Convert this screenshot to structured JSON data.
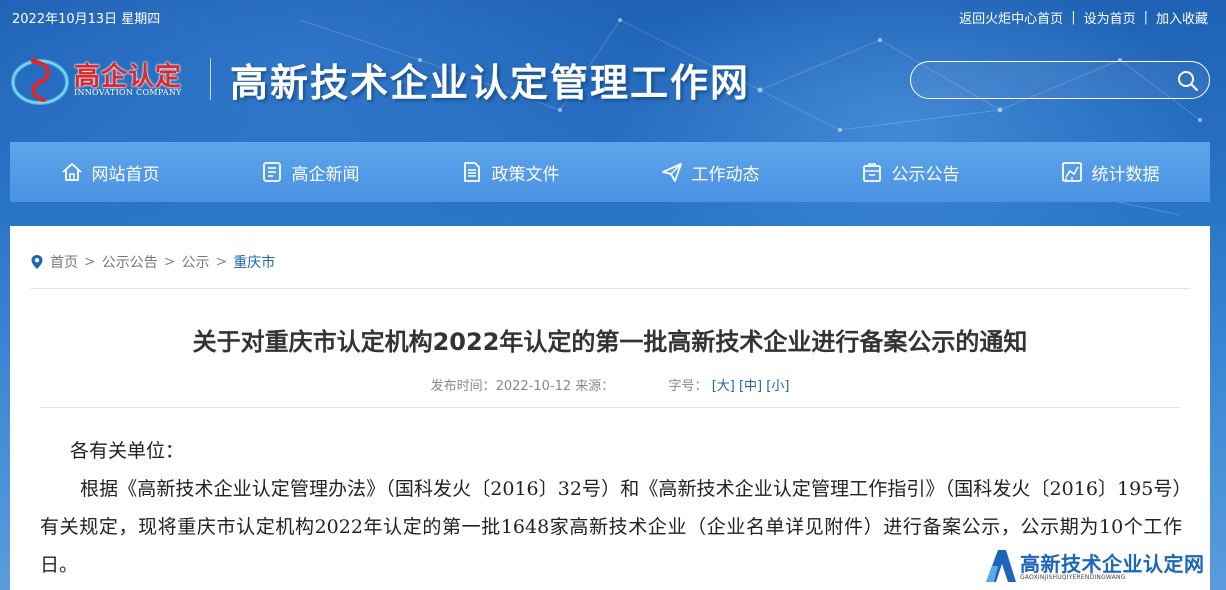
{
  "topbar": {
    "date": "2022年10月13日 星期四",
    "links": [
      "返回火炬中心首页",
      "设为首页",
      "加入收藏"
    ]
  },
  "logo": {
    "brand": "高企认定",
    "brand_en": "INNOVATION COMPANY"
  },
  "site_title": "高新技术企业认定管理工作网",
  "search": {
    "value": "",
    "placeholder": ""
  },
  "nav": [
    {
      "label": "网站首页",
      "icon": "home-icon"
    },
    {
      "label": "高企新闻",
      "icon": "news-icon"
    },
    {
      "label": "政策文件",
      "icon": "document-icon"
    },
    {
      "label": "工作动态",
      "icon": "paper-plane-icon"
    },
    {
      "label": "公示公告",
      "icon": "announcement-icon"
    },
    {
      "label": "统计数据",
      "icon": "chart-icon"
    }
  ],
  "breadcrumb": [
    "首页",
    "公示公告",
    "公示",
    "重庆市"
  ],
  "breadcrumb_sep": ">",
  "article": {
    "title": "关于对重庆市认定机构2022年认定的第一批高新技术企业进行备案公示的通知",
    "meta_publish": "发布时间：2022-10-12 来源：",
    "meta_fontsize_label": "字号：",
    "font_sizes": [
      "[大]",
      "[中]",
      "[小]"
    ],
    "greeting": "各有关单位：",
    "paragraph": "根据《高新技术企业认定管理办法》（国科发火〔2016〕32号）和《高新技术企业认定管理工作指引》（国科发火〔2016〕195号）有关规定，现将重庆市认定机构2022年认定的第一批1648家高新技术企业（企业名单详见附件）进行备案公示，公示期为10个工作日。"
  },
  "watermark": {
    "text": "高新技术企业认定网",
    "sub": "GAOXINJISHUQIYERENDINGWANG"
  },
  "colors": {
    "nav_bg": "#4a93e2",
    "link_blue": "#1d65b8",
    "brand_red": "#e0262a"
  }
}
